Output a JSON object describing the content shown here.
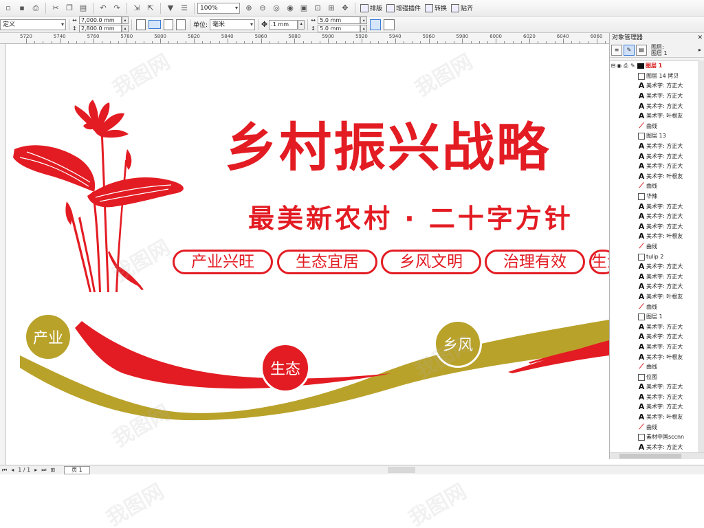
{
  "toolbar1": {
    "zoom": "100%",
    "buttons": [
      "排版",
      "增强插件",
      "转换",
      "贴齐"
    ]
  },
  "toolbar2": {
    "preset": "定义",
    "width": "7,000.0 mm",
    "height": "2,800.0 mm",
    "unit_label": "单位:",
    "unit_value": "毫米",
    "nudge": ".1 mm",
    "dup_x": "5.0 mm",
    "dup_y": "5.0 mm"
  },
  "ruler": {
    "labels": [
      "5720",
      "5740",
      "5760",
      "5780",
      "5800",
      "5820",
      "5840",
      "5860",
      "5880",
      "5900",
      "5920",
      "5940",
      "5960",
      "5980",
      "6000",
      "6020",
      "6040",
      "6060"
    ]
  },
  "artwork": {
    "title": "乡村振兴战略",
    "subtitle": "最美新农村 · 二十字方针",
    "pills": [
      "产业兴旺",
      "生态宜居",
      "乡风文明",
      "治理有效",
      "生活富裕"
    ],
    "circles": [
      "产业",
      "生态",
      "乡风"
    ],
    "colors": {
      "red": "#e31c23",
      "gold": "#b9a22a"
    }
  },
  "object_manager": {
    "title": "对象管理器",
    "header_line1": "图层:",
    "header_line2": "图层 1",
    "layer_name": "图层 1",
    "rows": [
      {
        "type": "group",
        "text": "图层 14 拷贝"
      },
      {
        "type": "text",
        "text": "美术字: 方正大"
      },
      {
        "type": "text",
        "text": "美术字: 方正大"
      },
      {
        "type": "text",
        "text": "美术字: 方正大"
      },
      {
        "type": "text",
        "text": "美术字: 叶根友"
      },
      {
        "type": "curve",
        "text": "曲线"
      },
      {
        "type": "group",
        "text": "图层 13"
      },
      {
        "type": "text",
        "text": "美术字: 方正大"
      },
      {
        "type": "text",
        "text": "美术字: 方正大"
      },
      {
        "type": "text",
        "text": "美术字: 方正大"
      },
      {
        "type": "text",
        "text": "美术字: 叶根友"
      },
      {
        "type": "curve",
        "text": "曲线"
      },
      {
        "type": "group",
        "text": "华辣"
      },
      {
        "type": "text",
        "text": "美术字: 方正大"
      },
      {
        "type": "text",
        "text": "美术字: 方正大"
      },
      {
        "type": "text",
        "text": "美术字: 方正大"
      },
      {
        "type": "text",
        "text": "美术字: 叶根友"
      },
      {
        "type": "curve",
        "text": "曲线"
      },
      {
        "type": "group",
        "text": "tulip 2"
      },
      {
        "type": "text",
        "text": "美术字: 方正大"
      },
      {
        "type": "text",
        "text": "美术字: 方正大"
      },
      {
        "type": "text",
        "text": "美术字: 方正大"
      },
      {
        "type": "text",
        "text": "美术字: 叶根友"
      },
      {
        "type": "curve",
        "text": "曲线"
      },
      {
        "type": "group",
        "text": "图层 1"
      },
      {
        "type": "text",
        "text": "美术字: 方正大"
      },
      {
        "type": "text",
        "text": "美术字: 方正大"
      },
      {
        "type": "text",
        "text": "美术字: 方正大"
      },
      {
        "type": "text",
        "text": "美术字: 叶根友"
      },
      {
        "type": "curve",
        "text": "曲线"
      },
      {
        "type": "group",
        "text": "位图"
      },
      {
        "type": "text",
        "text": "美术字: 方正大"
      },
      {
        "type": "text",
        "text": "美术字: 方正大"
      },
      {
        "type": "text",
        "text": "美术字: 方正大"
      },
      {
        "type": "text",
        "text": "美术字: 叶根友"
      },
      {
        "type": "curve",
        "text": "曲线"
      },
      {
        "type": "group",
        "text": "素材中国sccnn"
      },
      {
        "type": "text",
        "text": "美术字: 方正大"
      }
    ]
  },
  "status": {
    "page_count": "1 / 1",
    "page_tab": "页 1"
  },
  "watermark": "我图网"
}
